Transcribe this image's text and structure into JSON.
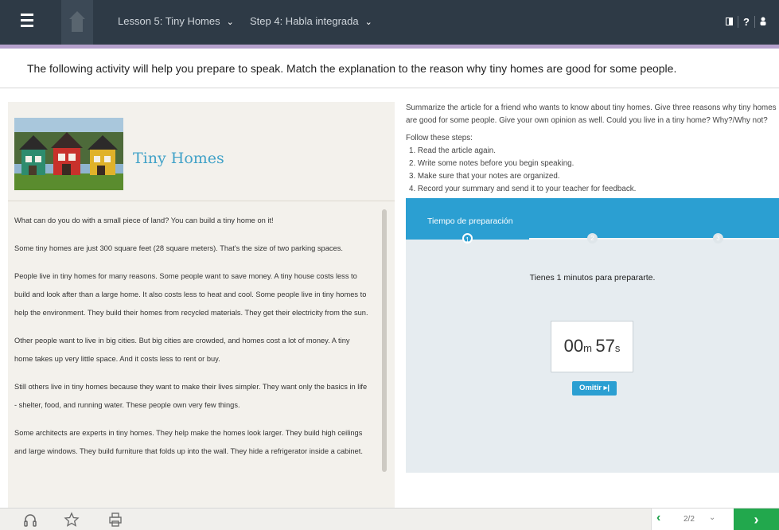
{
  "topbar": {
    "lesson_label": "Lesson 5: Tiny Homes",
    "step_label": "Step 4: Habla integrada",
    "chevron": "⌄",
    "right_icons": [
      "book-icon",
      "help-icon",
      "user-icon"
    ],
    "help_glyph": "?"
  },
  "instruction": "The following activity will help you prepare to speak. Match the explanation to the reason why tiny homes are good for some people.",
  "article": {
    "title": "Tiny Homes",
    "paragraphs": [
      "What can do you do with a small piece of land? You can build a tiny home on it!",
      "Some tiny homes are just 300 square feet (28 square meters). That's the size of two parking spaces.",
      "People live in tiny homes for many reasons. Some people want to save money. A tiny house costs less to build and look after than a large home. It also costs less to heat and cool. Some people live in tiny homes to help the environment. They build their homes from recycled materials. They get their electricity from the sun.",
      "Other people want to live in big cities. But big cities are crowded, and homes cost a lot of money. A tiny home takes up very little space. And it costs less to rent or buy.",
      "Still others live in tiny homes because they want to make their lives simpler. They want only the basics in life - shelter, food, and running water. These people own very few things.",
      "Some architects are experts in tiny homes. They help make the homes look larger. They build high ceilings and large windows. They build furniture that folds up into the wall. They hide a refrigerator inside a cabinet."
    ]
  },
  "task": {
    "summary": "Summarize the article for a friend who wants to know about tiny homes. Give three reasons why tiny homes are good for some people. Give your own opinion as well. Could you live in a tiny home? Why?/Why not?",
    "steps_title": "Follow these steps:",
    "steps": [
      "1. Read the article again.",
      "2. Write some notes before you begin speaking.",
      "3. Make sure that your notes are organized.",
      "4. Record your summary and send it to your teacher for feedback."
    ]
  },
  "recorder": {
    "bar_label": "Tiempo de preparación",
    "step_numbers": [
      "1",
      "2",
      "3"
    ],
    "active_step": 1,
    "prep_message": "Tienes 1 minutos para prepararte.",
    "timer_minutes": "00",
    "timer_minutes_unit": "m",
    "timer_seconds": "57",
    "timer_seconds_unit": "s",
    "skip_label": "Omitir ▸|"
  },
  "bottombar": {
    "icons": [
      "headphones-icon",
      "star-icon",
      "print-icon"
    ],
    "page_indicator": "2/2",
    "page_chevron": "⌄",
    "prev_glyph": "‹",
    "next_glyph": "›"
  },
  "colors": {
    "topbar": "#2e3a46",
    "accent": "#2b9fd2",
    "accent_line": "#b5a0cc",
    "next_button": "#22a84d",
    "article_title": "#41a2c8"
  }
}
